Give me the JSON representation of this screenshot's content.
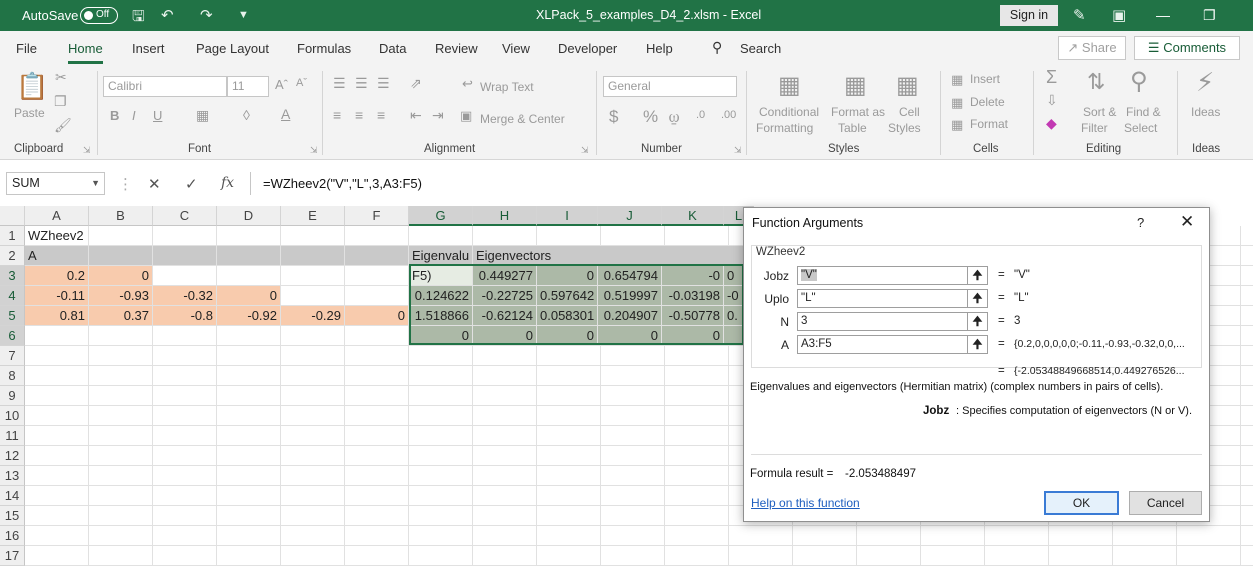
{
  "titlebar": {
    "autosave_label": "AutoSave",
    "autosave_state": "Off",
    "doc_title": "XLPack_5_examples_D4_2.xlsm  -  Excel",
    "signin": "Sign in"
  },
  "menu": {
    "tabs": [
      "File",
      "Home",
      "Insert",
      "Page Layout",
      "Formulas",
      "Data",
      "Review",
      "View",
      "Developer",
      "Help"
    ],
    "active": "Home",
    "search": "Search",
    "share": "Share",
    "comments": "Comments"
  },
  "ribbon": {
    "clipboard": {
      "paste": "Paste",
      "label": "Clipboard"
    },
    "font": {
      "name": "Calibri",
      "size": "11",
      "label": "Font"
    },
    "alignment": {
      "wrap": "Wrap Text",
      "merge": "Merge & Center",
      "label": "Alignment"
    },
    "number": {
      "format": "General",
      "label": "Number"
    },
    "styles": {
      "conditional_1": "Conditional",
      "conditional_2": "Formatting",
      "table_1": "Format as",
      "table_2": "Table",
      "cell_1": "Cell",
      "cell_2": "Styles",
      "label": "Styles"
    },
    "cells": {
      "insert": "Insert",
      "delete": "Delete",
      "format": "Format",
      "label": "Cells"
    },
    "editing": {
      "sort_1": "Sort &",
      "sort_2": "Filter",
      "find_1": "Find &",
      "find_2": "Select",
      "label": "Editing"
    },
    "ideas": {
      "btn": "Ideas",
      "label": "Ideas"
    }
  },
  "formula_bar": {
    "name_box": "SUM",
    "formula": "=WZheev2(\"V\",\"L\",3,A3:F5)"
  },
  "sheet": {
    "columns": [
      "A",
      "B",
      "C",
      "D",
      "E",
      "F",
      "G",
      "H",
      "I",
      "J",
      "K",
      "L"
    ],
    "rows": [
      "1",
      "2",
      "3",
      "4",
      "5",
      "6",
      "7",
      "8",
      "9",
      "10",
      "11",
      "12",
      "13",
      "14",
      "15",
      "16",
      "17"
    ],
    "a1": "WZheev2",
    "a2": "A",
    "g2": "Eigenvalu",
    "h2": "Eigenvectors",
    "g3": "F5)",
    "r3": [
      "0.2",
      "0",
      "",
      "",
      "",
      ""
    ],
    "r4": [
      "-0.11",
      "-0.93",
      "-0.32",
      "0",
      "",
      ""
    ],
    "r5": [
      "0.81",
      "0.37",
      "-0.8",
      "-0.92",
      "-0.29",
      "0"
    ],
    "g_vals": [
      "0.124622",
      "1.518866",
      "0"
    ],
    "h_vals": [
      "0.449277",
      "-0.22725",
      "-0.62124",
      "0"
    ],
    "i_vals": [
      "0",
      "0.597642",
      "0.058301",
      "0"
    ],
    "j_vals": [
      "0.654794",
      "0.519997",
      "0.204907",
      "0"
    ],
    "k_vals": [
      "-0",
      "-0.03198",
      "-0.50778",
      "0"
    ],
    "l_vals": [
      "0",
      "-0",
      "0.",
      ""
    ]
  },
  "dialog": {
    "title": "Function Arguments",
    "help_q": "?",
    "fn_name": "WZheev2",
    "args": [
      {
        "label": "Jobz",
        "value": "\"V\"",
        "result": "\"V\""
      },
      {
        "label": "Uplo",
        "value": "\"L\"",
        "result": "\"L\""
      },
      {
        "label": "N",
        "value": "3",
        "result": "3"
      },
      {
        "label": "A",
        "value": "A3:F5",
        "result": "{0.2,0,0,0,0,0;-0.11,-0.93,-0.32,0,0,..."
      }
    ],
    "total_result": "{-2.05348849668514,0.449276526...",
    "description": "Eigenvalues and eigenvectors (Hermitian matrix) (complex numbers in pairs of cells).",
    "arg_name": "Jobz",
    "arg_desc": ": Specifies computation of eigenvectors (N or V).",
    "formula_result_label": "Formula result =",
    "formula_result": "-2.053488497",
    "help_link": "Help on this function",
    "ok": "OK",
    "cancel": "Cancel"
  }
}
